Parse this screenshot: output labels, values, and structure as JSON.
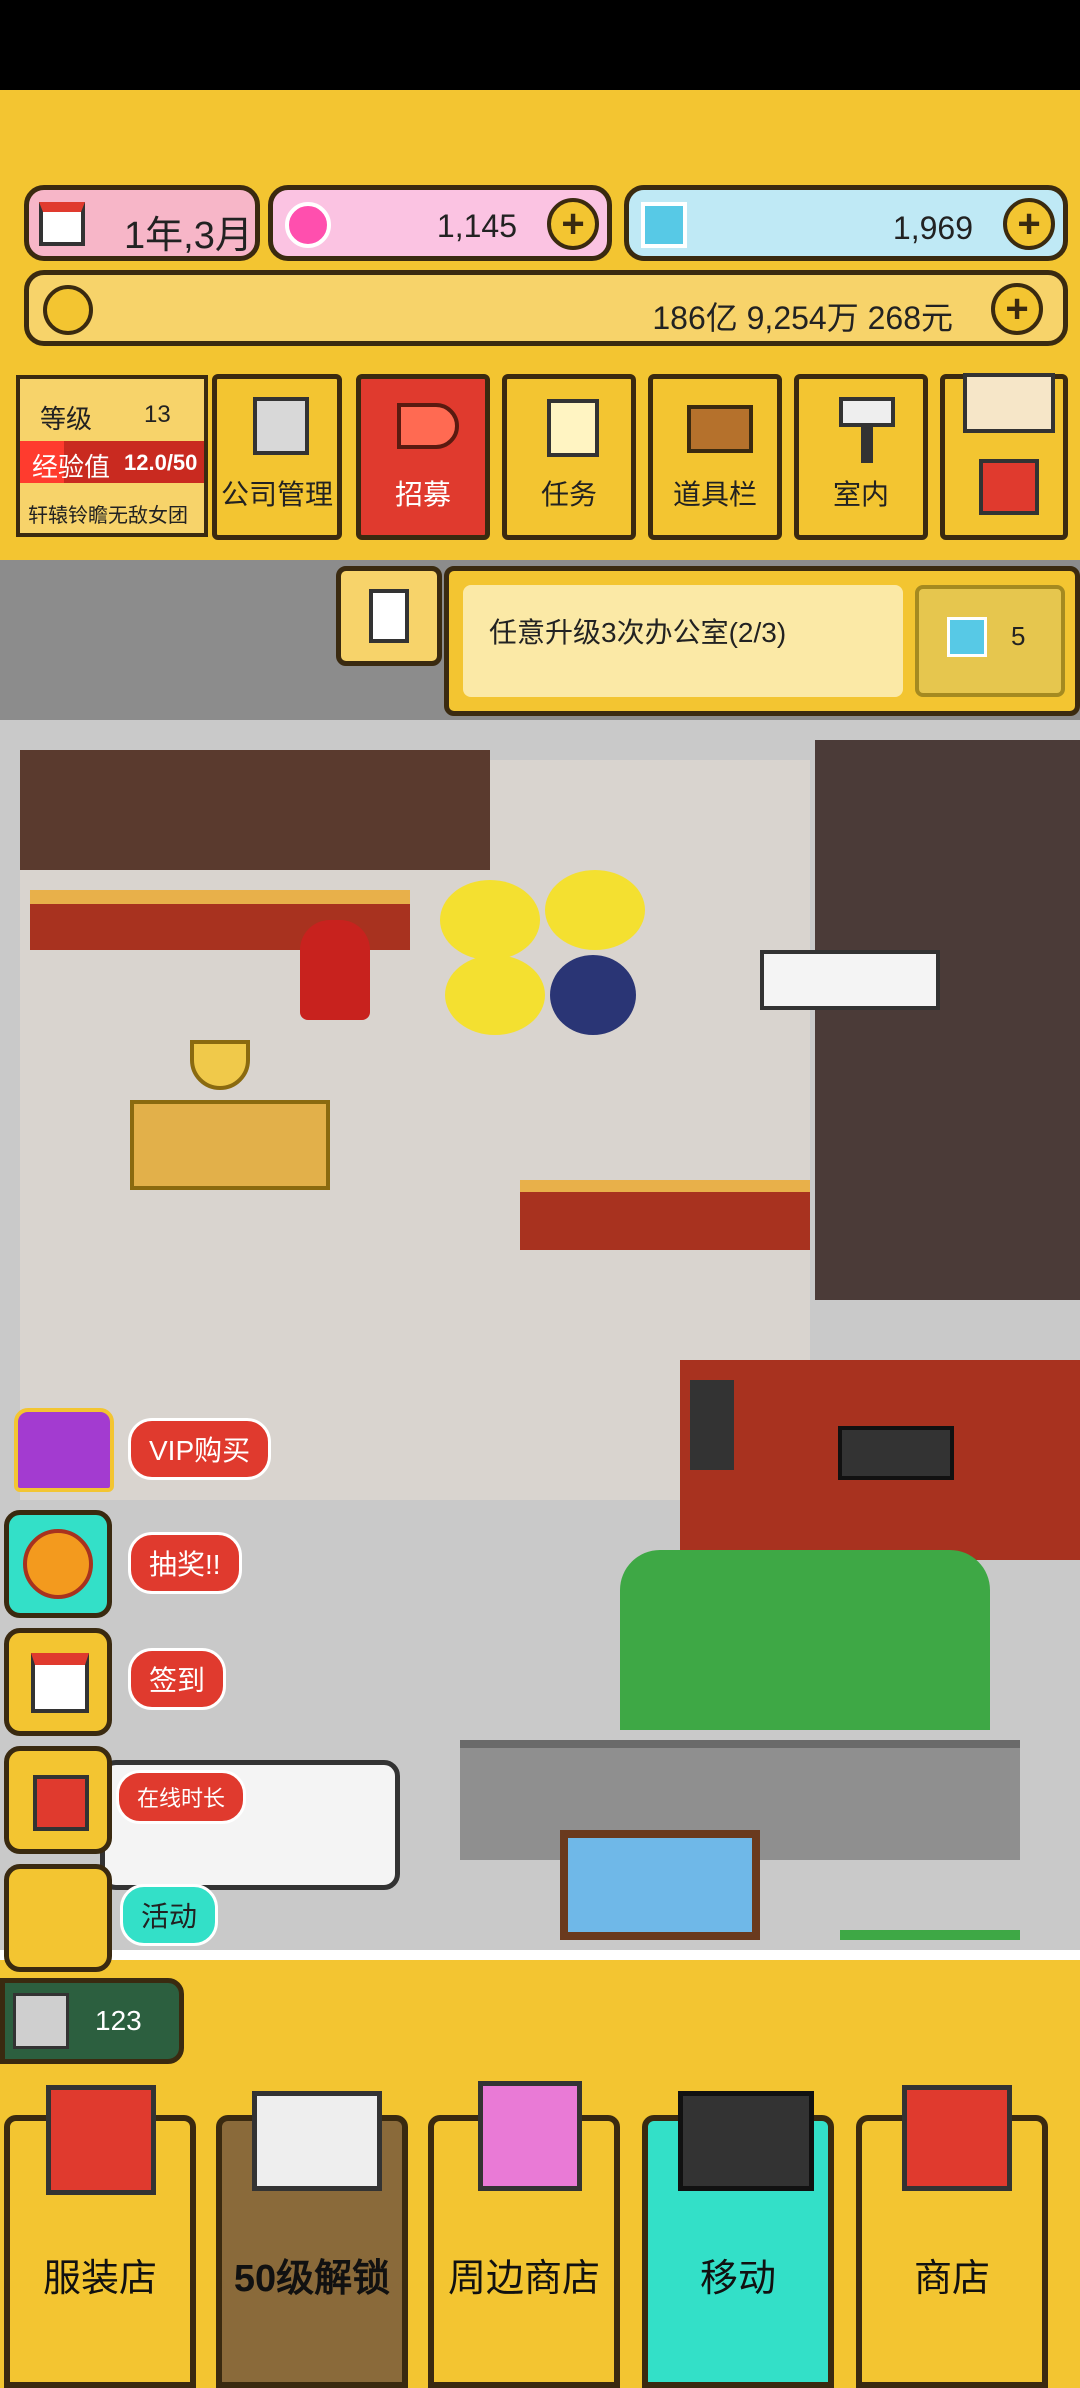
{
  "status_bar": {},
  "header": {
    "date": "1年,3月",
    "pink_currency": "1,145",
    "diamond_currency": "1,969",
    "money": "186亿 9,254万 268元"
  },
  "level_panel": {
    "level_label": "等级",
    "level_value": "13",
    "exp_label": "经验值",
    "exp_value": "12.0/50",
    "company_name": "轩辕铃瞻无敌女团"
  },
  "top_menu": [
    {
      "label": "公司管理"
    },
    {
      "label": "招募"
    },
    {
      "label": "任务"
    },
    {
      "label": "道具栏"
    },
    {
      "label": "室内"
    },
    {
      "label": ""
    }
  ],
  "quest": {
    "text": "任意升级3次办公室(2/3)",
    "reward": "5"
  },
  "side_menu": [
    {
      "label": "VIP购买",
      "icon": "crown-icon"
    },
    {
      "label": "抽奖!!",
      "icon": "wheel-icon"
    },
    {
      "label": "签到",
      "icon": "calendar-icon"
    },
    {
      "label": "在线时长",
      "icon": "gift-icon"
    },
    {
      "label": "活动",
      "icon": "scissors-icon"
    }
  ],
  "cat_counter": "123",
  "bottom_nav": [
    {
      "label": "服装店"
    },
    {
      "label": "50级解锁"
    },
    {
      "label": "周边商店"
    },
    {
      "label": "移动"
    },
    {
      "label": "商店"
    }
  ],
  "colors": {
    "accent_yellow": "#f3c531",
    "recruit_red": "#e03a2e",
    "move_teal": "#33e0c8"
  }
}
